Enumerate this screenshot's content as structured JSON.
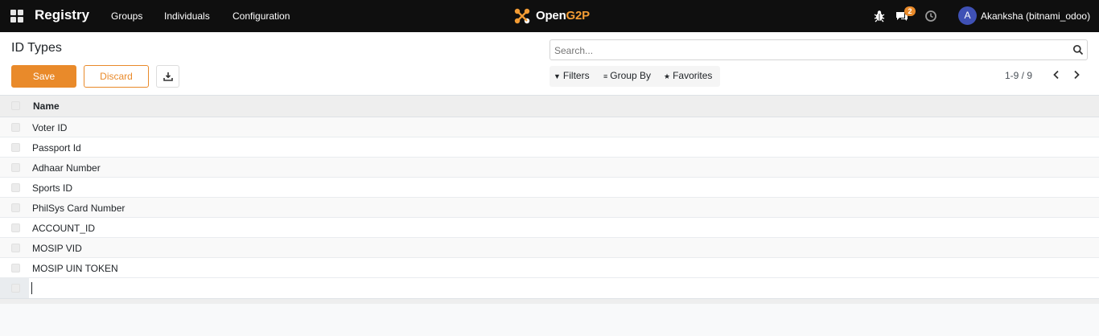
{
  "topbar": {
    "app_name": "Registry",
    "menu": [
      "Groups",
      "Individuals",
      "Configuration"
    ],
    "logo": {
      "text_main": "Open",
      "text_accent": "G2P"
    },
    "notification_count": "2",
    "user": {
      "initial": "A",
      "name": "Akanksha (bitnami_odoo)"
    },
    "icons": [
      "apps-grid-icon",
      "bug-icon",
      "chat-icon",
      "clock-icon"
    ]
  },
  "control": {
    "title": "ID Types",
    "save_label": "Save",
    "discard_label": "Discard",
    "search_placeholder": "Search...",
    "filters_label": "Filters",
    "groupby_label": "Group By",
    "favorites_label": "Favorites",
    "pager": "1-9 / 9"
  },
  "table": {
    "header": "Name",
    "rows": [
      "Voter ID",
      "Passport Id",
      "Adhaar Number",
      "Sports ID",
      "PhilSys Card Number",
      "ACCOUNT_ID",
      "MOSIP VID",
      "MOSIP UIN TOKEN"
    ]
  },
  "colors": {
    "accent": "#e98a2a",
    "topbar": "#0f0f0f",
    "avatar": "#3f51b5"
  }
}
